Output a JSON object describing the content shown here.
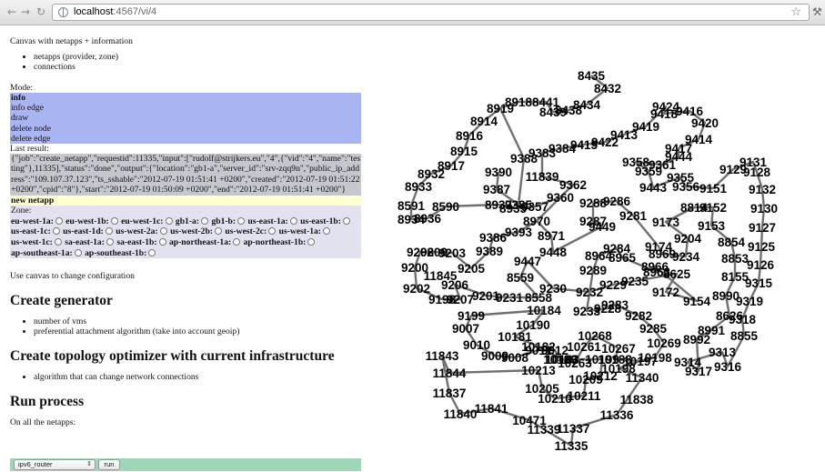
{
  "browser": {
    "url_host": "localhost",
    "url_rest": ":4567/vi/4"
  },
  "page": {
    "intro": "Canvas with netapps + information",
    "info_items": [
      "netapps (provider, zone)",
      "connections"
    ],
    "mode_label": "Mode:",
    "modes": [
      "info",
      "info edge",
      "draw",
      "delete node",
      "delete edge"
    ],
    "active_mode": "info",
    "last_result_label": "Last result:",
    "last_result": "{\"job\":\"create_netapp\",\"requestid\":11335,\"input\":[\"rudolf@strijkers.eu\",\"4\",{\"vid\":\"4\",\"name\":\"testing\"},11335],\"status\":\"done\",\"output\":{\"location\":\"gb1-a\",\"server_id\":\"srv-zqq9n\",\"public_ip_address\":\"109.107.37.123\",\"ts_sshable\":\"2012-07-19 01:51:41 +0200\",\"created\":\"2012-07-19 01:51:22 +0200\",\"cpid\":\"8\"},\"start\":\"2012-07-19 01:50:09 +0200\",\"end\":\"2012-07-19 01:51:41 +0200\"}",
    "action": "new netapp",
    "zone_label": "Zone:",
    "zones": [
      "eu-west-1a:",
      "eu-west-1b:",
      "eu-west-1c:",
      "gb1-a:",
      "gb1-b:",
      "us-east-1a:",
      "us-east-1b:",
      "us-east-1c:",
      "us-east-1d:",
      "us-west-2a:",
      "us-west-2b:",
      "us-west-2c:",
      "us-west-1a:",
      "us-west-1c:",
      "sa-east-1a:",
      "sa-east-1b:",
      "ap-northeast-1a:",
      "ap-northeast-1b:",
      "ap-southeast-1a:",
      "ap-southeast-1b:"
    ],
    "canvas_note": "Use canvas to change configuration",
    "create_generator_heading": "Create generator",
    "generator_items": [
      "number of vms",
      "preferential attachment algorithm (take into account geoip)"
    ],
    "topology_heading": "Create topology optimizer with current infrastructure",
    "topology_items": [
      "algorithm that can change network connections"
    ],
    "run_heading": "Run process",
    "run_note": "On all the netapps:",
    "run_select_value": "ipv6_router",
    "run_button": "run"
  },
  "graph": {
    "edge_color": "#707070",
    "nodes": [
      "8435",
      "8432",
      "8441",
      "8434",
      "8438",
      "8439",
      "8919",
      "8918",
      "8914",
      "8916",
      "8915",
      "8917",
      "8932",
      "8933",
      "8591",
      "8934",
      "8936",
      "8590",
      "9424",
      "9416",
      "9418",
      "9420",
      "9419",
      "9413",
      "9414",
      "9417",
      "9422",
      "9415",
      "9384",
      "9383",
      "9388",
      "9390",
      "9387",
      "9386",
      "9385",
      "9389",
      "9393",
      "9361",
      "9444",
      "9355",
      "9356",
      "9358",
      "9359",
      "11839",
      "9362",
      "9360",
      "9288",
      "9286",
      "9287",
      "9443",
      "9131",
      "9129",
      "9128",
      "9132",
      "9130",
      "9127",
      "9125",
      "9126",
      "9315",
      "9319",
      "9318",
      "9151",
      "9152",
      "9153",
      "8854",
      "8853",
      "8155",
      "8990",
      "8626",
      "8855",
      "8814",
      "9173",
      "9204",
      "9234",
      "9235",
      "9232",
      "9233",
      "9230",
      "9231",
      "9228",
      "9229",
      "9208",
      "9209",
      "9203",
      "9205",
      "9206",
      "9207",
      "9200",
      "9202",
      "9198",
      "9199",
      "9201",
      "11845",
      "8559",
      "8558",
      "8970",
      "8971",
      "8969",
      "8966",
      "8965",
      "8963",
      "8962",
      "8964",
      "9449",
      "9447",
      "9448",
      "9289",
      "9283",
      "9282",
      "9285",
      "9284",
      "9281",
      "9154",
      "9172",
      "9174",
      "8625",
      "8991",
      "8992",
      "9007",
      "9010",
      "9009",
      "9008",
      "9011",
      "9012",
      "9313",
      "9314",
      "9316",
      "9317",
      "11843",
      "11844",
      "11837",
      "11840",
      "11841",
      "11838",
      "11336",
      "11337",
      "11339",
      "11335",
      "11340",
      "10471",
      "10184",
      "10190",
      "10181",
      "10182",
      "10183",
      "10188",
      "10198",
      "10199",
      "10213",
      "10205",
      "10209",
      "10210",
      "10211",
      "10267",
      "10268",
      "10261",
      "10263",
      "10198b",
      "10269",
      "10189",
      "10197",
      "10212",
      "9357",
      "8935",
      "8937"
    ]
  }
}
